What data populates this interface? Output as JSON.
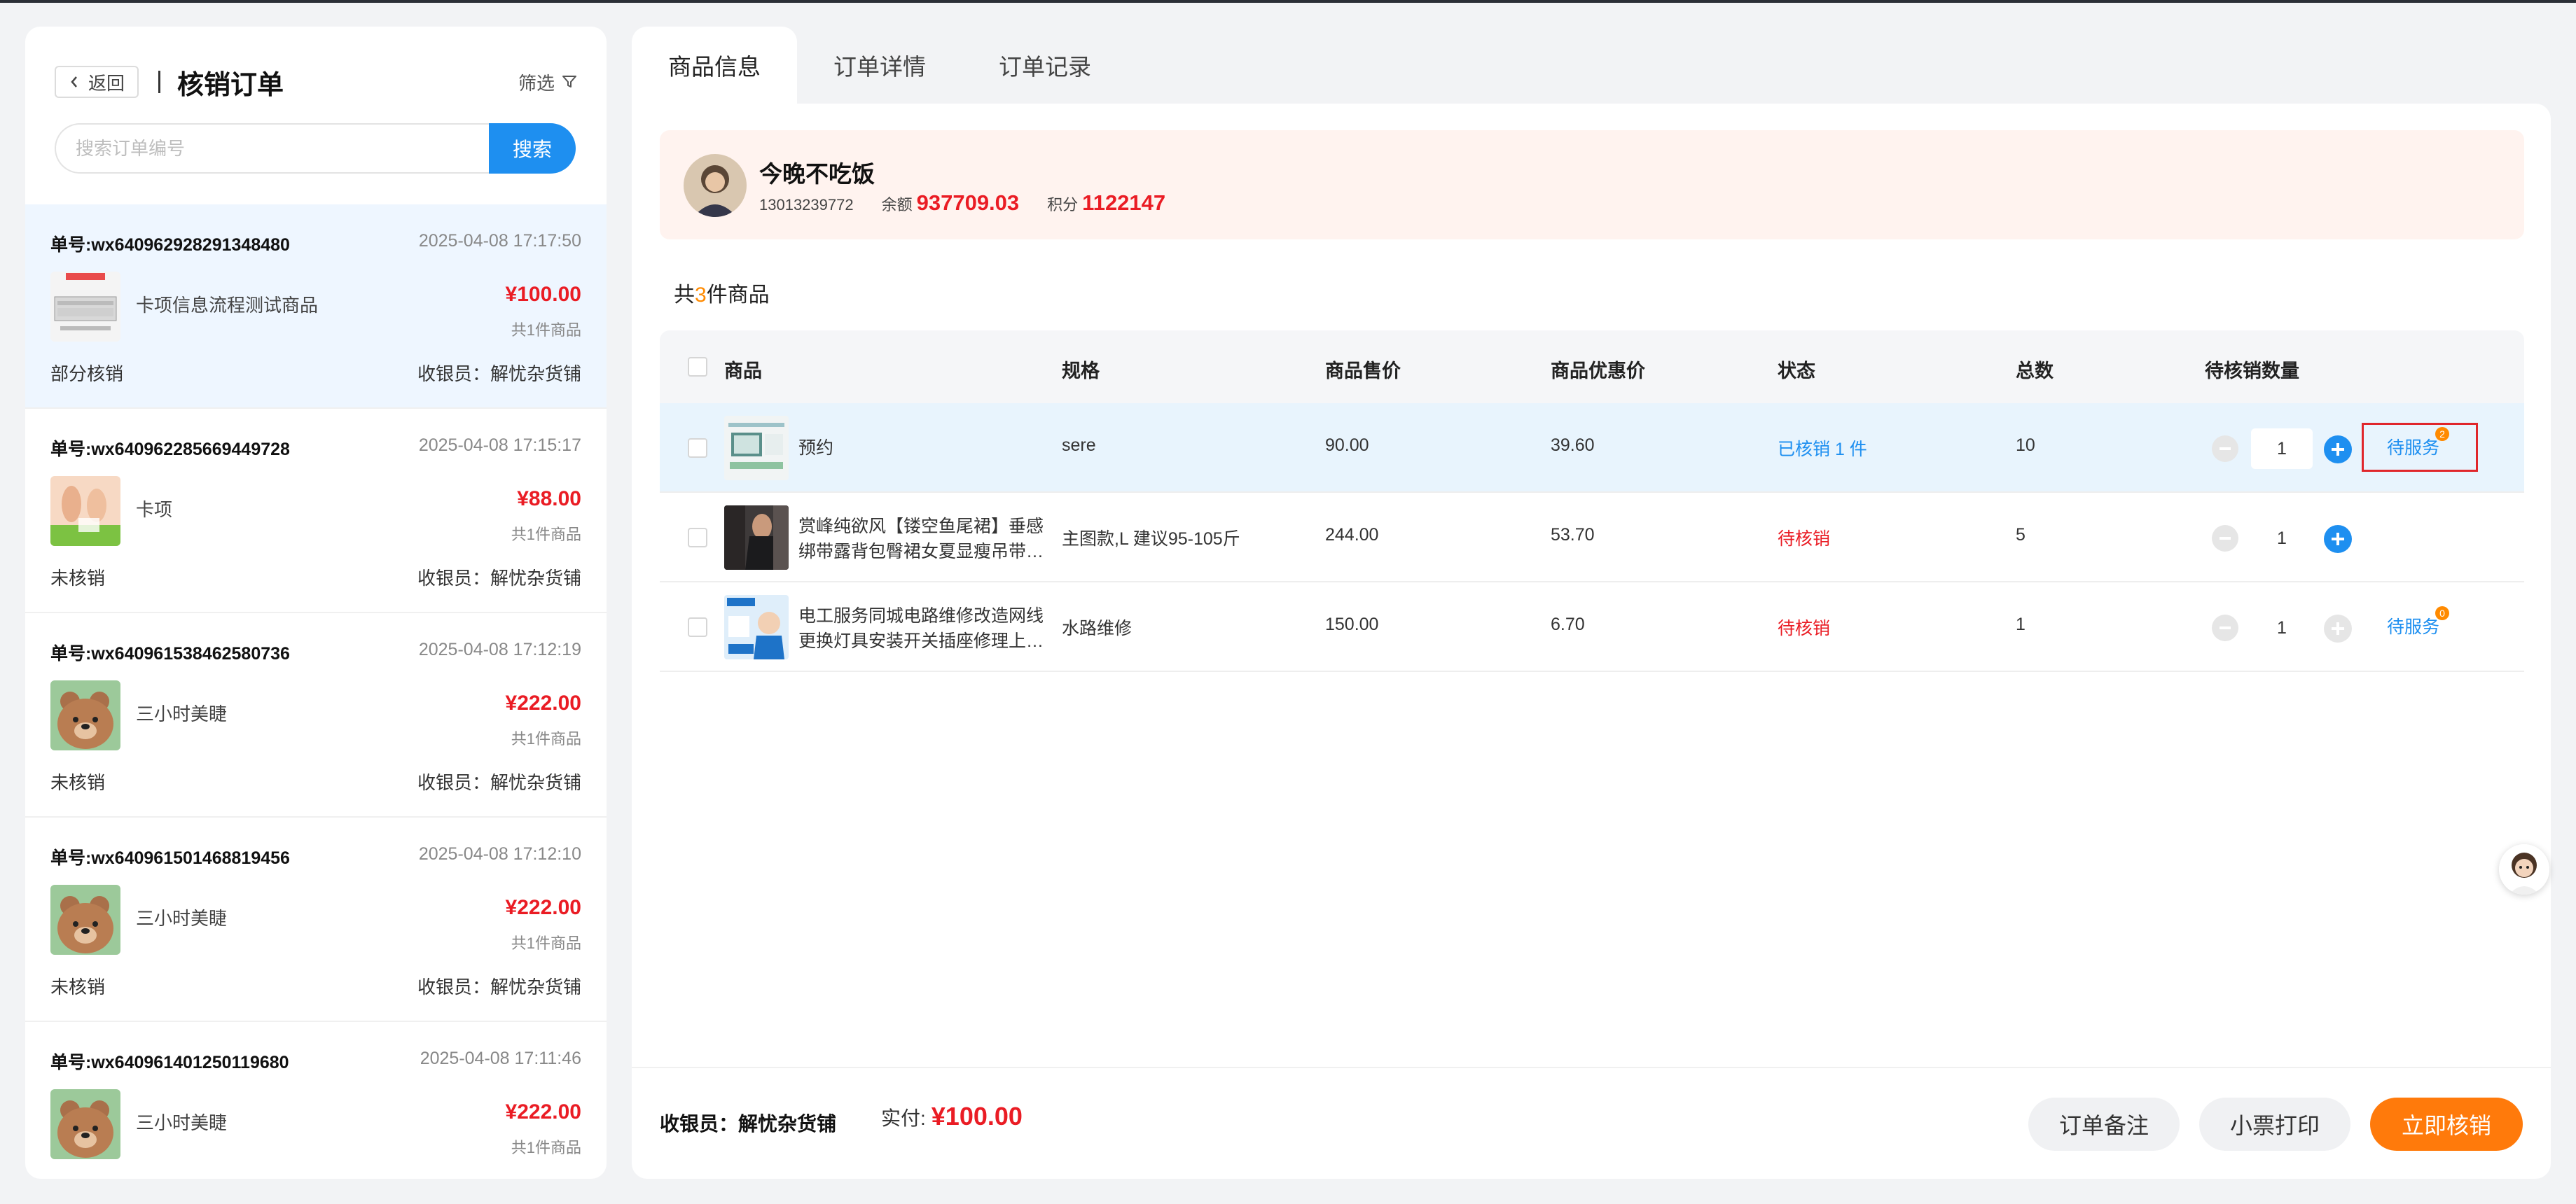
{
  "left": {
    "back_label": "返回",
    "title": "核销订单",
    "filter_label": "筛选",
    "search_placeholder": "搜索订单编号",
    "search_button": "搜索",
    "orders": [
      {
        "no": "单号:wx640962928291348480",
        "time": "2025-04-08 17:17:50",
        "name": "卡项信息流程测试商品",
        "price": "¥100.00",
        "count": "共1件商品",
        "status": "部分核销",
        "cashier": "收银员：解忧杂货铺",
        "thumb": "device-thumb"
      },
      {
        "no": "单号:wx640962285669449728",
        "time": "2025-04-08 17:15:17",
        "name": "卡项",
        "price": "¥88.00",
        "count": "共1件商品",
        "status": "未核销",
        "cashier": "收银员：解忧杂货铺",
        "thumb": "massage-thumb"
      },
      {
        "no": "单号:wx640961538462580736",
        "time": "2025-04-08 17:12:19",
        "name": "三小时美睫",
        "price": "¥222.00",
        "count": "共1件商品",
        "status": "未核销",
        "cashier": "收银员：解忧杂货铺",
        "thumb": "bear-thumb"
      },
      {
        "no": "单号:wx640961501468819456",
        "time": "2025-04-08 17:12:10",
        "name": "三小时美睫",
        "price": "¥222.00",
        "count": "共1件商品",
        "status": "未核销",
        "cashier": "收银员：解忧杂货铺",
        "thumb": "bear-thumb"
      },
      {
        "no": "单号:wx640961401250119680",
        "time": "2025-04-08 17:11:46",
        "name": "三小时美睫",
        "price": "¥222.00",
        "count": "共1件商品",
        "status": "",
        "cashier": "",
        "thumb": "bear-thumb"
      }
    ]
  },
  "tabs": [
    "商品信息",
    "订单详情",
    "订单记录"
  ],
  "member": {
    "name": "今晚不吃饭",
    "phone": "13013239772",
    "balance_label": "余额",
    "balance": "937709.03",
    "points_label": "积分",
    "points": "1122147"
  },
  "goods_summary": {
    "prefix": "共",
    "count": "3",
    "suffix": "件商品"
  },
  "table": {
    "headers": [
      "商品",
      "规格",
      "商品售价",
      "商品优惠价",
      "状态",
      "总数",
      "待核销数量"
    ],
    "rows": [
      {
        "name": "预约",
        "spec": "sere",
        "price": "90.00",
        "discount": "39.60",
        "status": "已核销 1 件",
        "total": "10",
        "qty": "1",
        "service": "待服务",
        "badge": "2"
      },
      {
        "name": "赏峰纯欲风【镂空鱼尾裙】垂感绑带露背包臀裙女夏显瘦吊带…",
        "spec": "主图款,L 建议95-105斤",
        "price": "244.00",
        "discount": "53.70",
        "status": "待核销",
        "total": "5",
        "qty": "1",
        "service": "",
        "badge": ""
      },
      {
        "name": "电工服务同城电路维修改造网线更换灯具安装开关插座修理上…",
        "spec": "水路维修",
        "price": "150.00",
        "discount": "6.70",
        "status": "待核销",
        "total": "1",
        "qty": "1",
        "service": "待服务",
        "badge": "0"
      }
    ]
  },
  "footer": {
    "cashier": "收银员：解忧杂货铺",
    "paid_label": "实付:",
    "paid_amount": "¥100.00",
    "note_button": "订单备注",
    "print_button": "小票打印",
    "verify_button": "立即核销"
  },
  "colors": {
    "accent": "#1e8ff0",
    "price_red": "#ea1c24",
    "orange": "#ff7a0b"
  }
}
